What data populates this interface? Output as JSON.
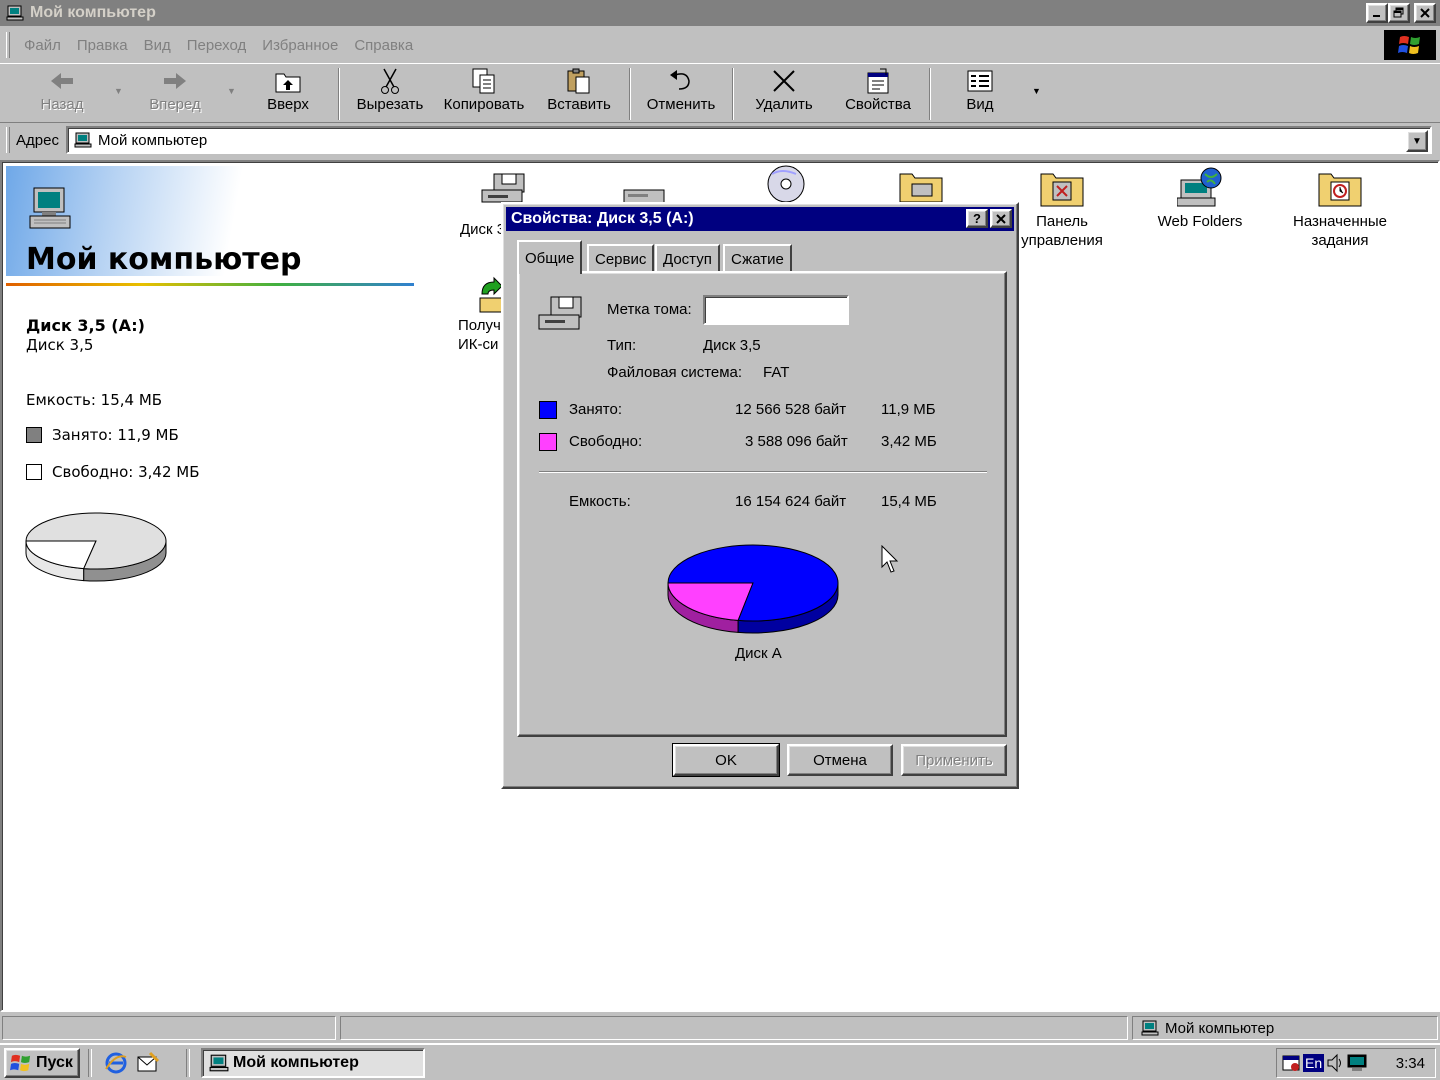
{
  "window": {
    "title": "Мой компьютер",
    "colors": {
      "desktop_gray": "#c0c0c0",
      "title_active": "#000080",
      "title_inactive": "#808080"
    }
  },
  "menu": [
    "Файл",
    "Правка",
    "Вид",
    "Переход",
    "Избранное",
    "Справка"
  ],
  "toolbar": {
    "back": "Назад",
    "forward": "Вперед",
    "up": "Вверх",
    "cut": "Вырезать",
    "copy": "Копировать",
    "paste": "Вставить",
    "undo": "Отменить",
    "delete": "Удалить",
    "properties": "Свойства",
    "view": "Вид"
  },
  "address": {
    "label": "Адрес",
    "value": "Мой компьютер"
  },
  "webview": {
    "title": "Мой компьютер",
    "selected_name": "Диск 3,5 (A:)",
    "selected_type": "Диск 3,5",
    "capacity": "Емкость: 15,4 МБ",
    "used": "Занято: 11,9 МБ",
    "free": "Свободно: 3,42 МБ",
    "used_fraction": 0.778
  },
  "icons": {
    "disk_a": "Диск 3",
    "control_panel_line1": "Панель",
    "control_panel_line2": "управления",
    "web_folders": "Web Folders",
    "scheduled_line1": "Назначенные",
    "scheduled_line2": "задания",
    "infrared_line1": "Получ",
    "infrared_line2": "ИК-си"
  },
  "dialog": {
    "title": "Свойства: Диск 3,5 (A:)",
    "help": "?",
    "close": "✕",
    "tabs": [
      "Общие",
      "Сервис",
      "Доступ",
      "Сжатие"
    ],
    "volume_label_caption": "Метка тома:",
    "volume_label_value": "",
    "type_caption": "Тип:",
    "type_value": "Диск 3,5",
    "fs_caption": "Файловая система:",
    "fs_value": "FAT",
    "used_caption": "Занято:",
    "used_bytes": "12 566 528 байт",
    "used_mb": "11,9 МБ",
    "free_caption": "Свободно:",
    "free_bytes": "3 588 096 байт",
    "free_mb": "3,42 МБ",
    "capacity_caption": "Емкость:",
    "capacity_bytes": "16 154 624 байт",
    "capacity_mb": "15,4 МБ",
    "disk_label": "Диск A",
    "used_color": "#0000ff",
    "free_color": "#ff40ff",
    "ok": "OK",
    "cancel": "Отмена",
    "apply": "Применить"
  },
  "statusbar": {
    "right": "Мой компьютер"
  },
  "taskbar": {
    "start": "Пуск",
    "task": "Мой компьютер",
    "lang": "En",
    "clock": "3:34"
  }
}
